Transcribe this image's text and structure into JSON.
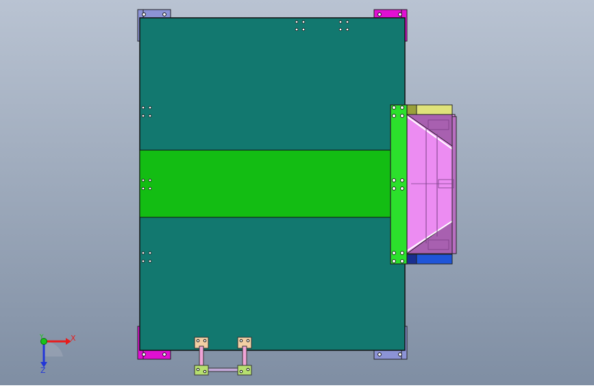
{
  "viewport": {
    "background_top": "#b9c3d2",
    "background_bottom": "#7f8ea3"
  },
  "colors": {
    "plate": "#12786f",
    "center_strip": "#13bd13",
    "bracket_green": "#2ce02c",
    "hopper_pink": "#ec8cf2",
    "hopper_purple": "#a860b0",
    "yellow_block": "#dfe27a",
    "blue_block": "#1f55d8",
    "corner_blue": "#8c93d6",
    "corner_magenta": "#e010d2",
    "handle_pink": "#f1a4d8",
    "handle_mount": "#f2cfa4",
    "axis_x": "#e81c1c",
    "axis_y": "#19c419",
    "axis_z": "#2236d8"
  },
  "triad": {
    "x_label": "X",
    "y_label": "Y",
    "z_label": "Z"
  }
}
